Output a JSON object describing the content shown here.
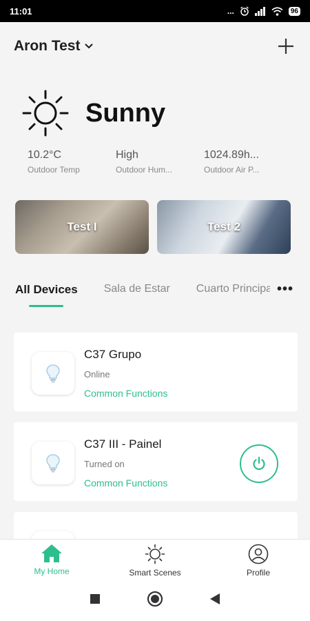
{
  "status_bar": {
    "time": "11:01",
    "indicators": "...",
    "battery": "96"
  },
  "header": {
    "home_name": "Aron Test",
    "dropdown_icon": "chevron-down-icon",
    "add_icon": "plus-icon"
  },
  "weather": {
    "condition": "Sunny",
    "icon": "sun-icon",
    "metrics": [
      {
        "value": "10.2°C",
        "label": "Outdoor Temp"
      },
      {
        "value": "High",
        "label": "Outdoor Hum..."
      },
      {
        "value": "1024.89h...",
        "label": "Outdoor Air P..."
      }
    ]
  },
  "scenes": [
    {
      "label": "Test I"
    },
    {
      "label": "Test 2"
    }
  ],
  "tabs": {
    "items": [
      {
        "label": "All Devices"
      },
      {
        "label": "Sala de Estar"
      },
      {
        "label": "Cuarto Principal"
      }
    ],
    "active_index": 0,
    "more_label": "•••"
  },
  "devices": [
    {
      "name": "C37 Grupo",
      "status": "Online",
      "function_link": "Common Functions",
      "icon": "light-bulb-icon"
    },
    {
      "name": "C37 III - Painel",
      "status": "Turned on",
      "function_link": "Common Functions",
      "icon": "light-bulb-icon",
      "power_icon": "power-icon",
      "power_color": "#2dbe8e"
    },
    {
      "name": "",
      "status": "",
      "function_link": ""
    }
  ],
  "bottom_nav": [
    {
      "label": "My Home",
      "icon": "home-icon",
      "active": true
    },
    {
      "label": "Smart Scenes",
      "icon": "sun-icon",
      "active": false
    },
    {
      "label": "Profile",
      "icon": "profile-icon",
      "active": false
    }
  ],
  "system_nav": {
    "recents_icon": "square-icon",
    "home_icon": "circle-icon",
    "back_icon": "back-triangle-icon"
  },
  "colors": {
    "accent": "#2dbe8e",
    "background": "#f4f4f4"
  }
}
